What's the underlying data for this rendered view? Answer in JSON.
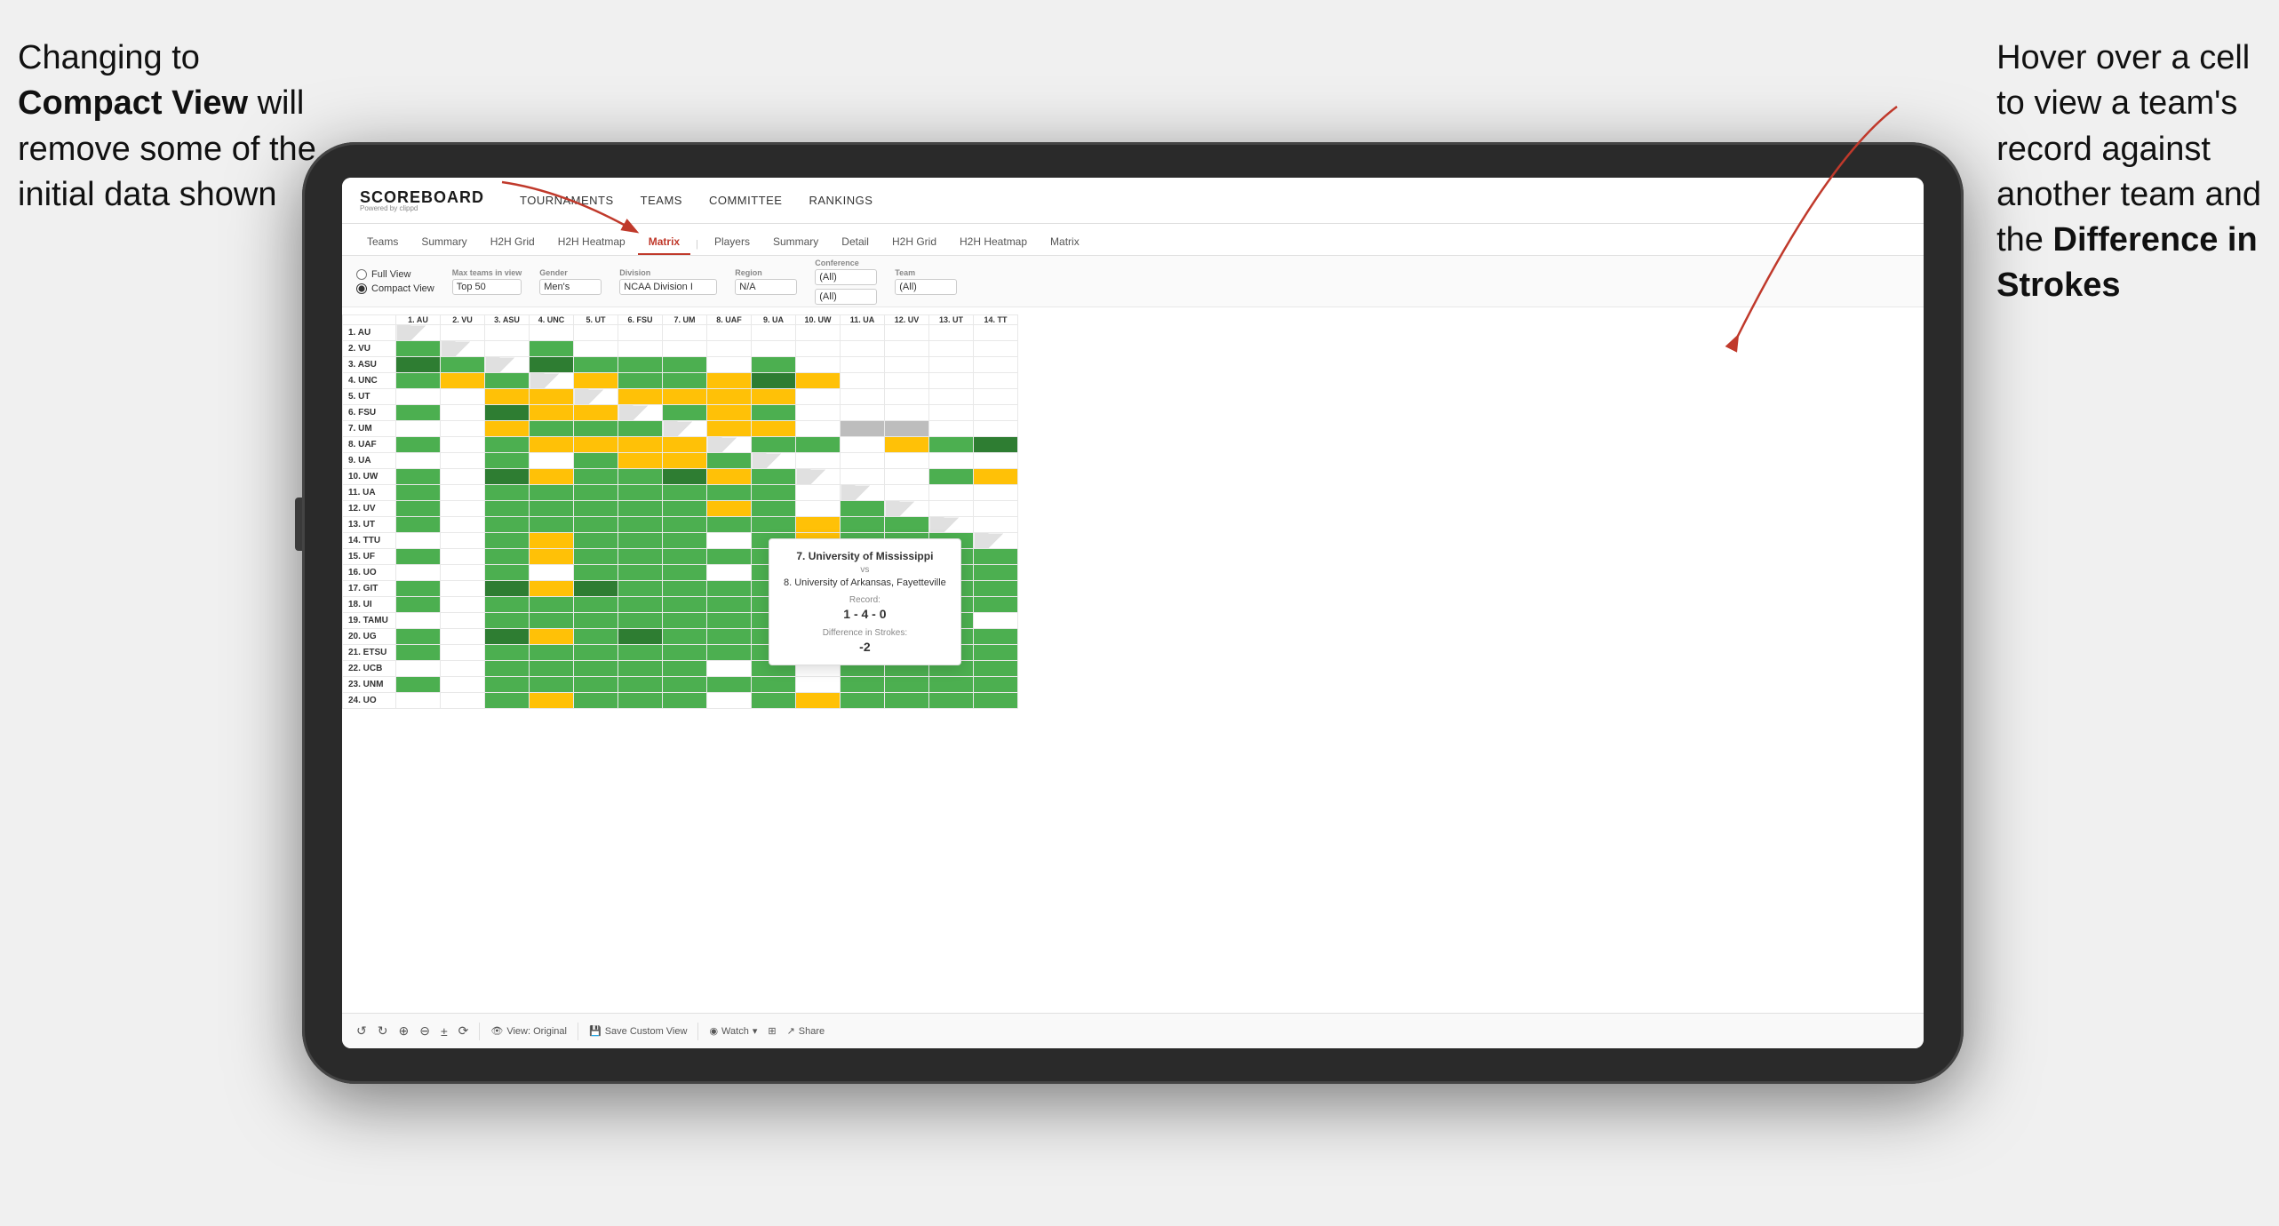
{
  "annotation_left": {
    "line1": "Changing to",
    "line2_bold": "Compact View",
    "line2_rest": " will",
    "line3": "remove some of the",
    "line4": "initial data shown"
  },
  "annotation_right": {
    "line1": "Hover over a cell",
    "line2": "to view a team's",
    "line3": "record against",
    "line4": "another team and",
    "line5_pre": "the ",
    "line5_bold": "Difference in",
    "line6_bold": "Strokes"
  },
  "header": {
    "logo": "SCOREBOARD",
    "logo_sub": "Powered by clippd",
    "nav": [
      "TOURNAMENTS",
      "TEAMS",
      "COMMITTEE",
      "RANKINGS"
    ]
  },
  "tabs": {
    "group1": [
      "Teams",
      "Summary",
      "H2H Grid",
      "H2H Heatmap",
      "Matrix"
    ],
    "group2": [
      "Players",
      "Summary",
      "Detail",
      "H2H Grid",
      "H2H Heatmap",
      "Matrix"
    ],
    "active": "Matrix"
  },
  "filters": {
    "view_options": [
      "Full View",
      "Compact View"
    ],
    "selected_view": "Compact View",
    "max_teams_label": "Max teams in view",
    "max_teams_value": "Top 50",
    "gender_label": "Gender",
    "gender_value": "Men's",
    "division_label": "Division",
    "division_value": "NCAA Division I",
    "region_label": "Region",
    "region_value": "N/A",
    "conference_label": "Conference",
    "conference_values": [
      "(All)",
      "(All)"
    ],
    "team_label": "Team",
    "team_value": "(All)"
  },
  "matrix": {
    "col_headers": [
      "1. AU",
      "2. VU",
      "3. ASU",
      "4. UNC",
      "5. UT",
      "6. FSU",
      "7. UM",
      "8. UAF",
      "9. UA",
      "10. UW",
      "11. UA",
      "12. UV",
      "13. UT",
      "14. TT"
    ],
    "row_headers": [
      "1. AU",
      "2. VU",
      "3. ASU",
      "4. UNC",
      "5. UT",
      "6. FSU",
      "7. UM",
      "8. UAF",
      "9. UA",
      "10. UW",
      "11. UA",
      "12. UV",
      "13. UT",
      "14. TTU",
      "15. UF",
      "16. UO",
      "17. GIT",
      "18. UI",
      "19. TAMU",
      "20. UG",
      "21. ETSU",
      "22. UCB",
      "23. UNM",
      "24. UO"
    ]
  },
  "tooltip": {
    "team1": "7. University of Mississippi",
    "vs": "vs",
    "team2": "8. University of Arkansas, Fayetteville",
    "record_label": "Record:",
    "record": "1 - 4 - 0",
    "diff_label": "Difference in Strokes:",
    "diff": "-2"
  },
  "toolbar": {
    "buttons": [
      "↺",
      "→",
      "⊕",
      "⊖",
      "±",
      "⟳"
    ],
    "view_original": "View: Original",
    "save_custom": "Save Custom View",
    "watch": "Watch",
    "share": "Share"
  }
}
